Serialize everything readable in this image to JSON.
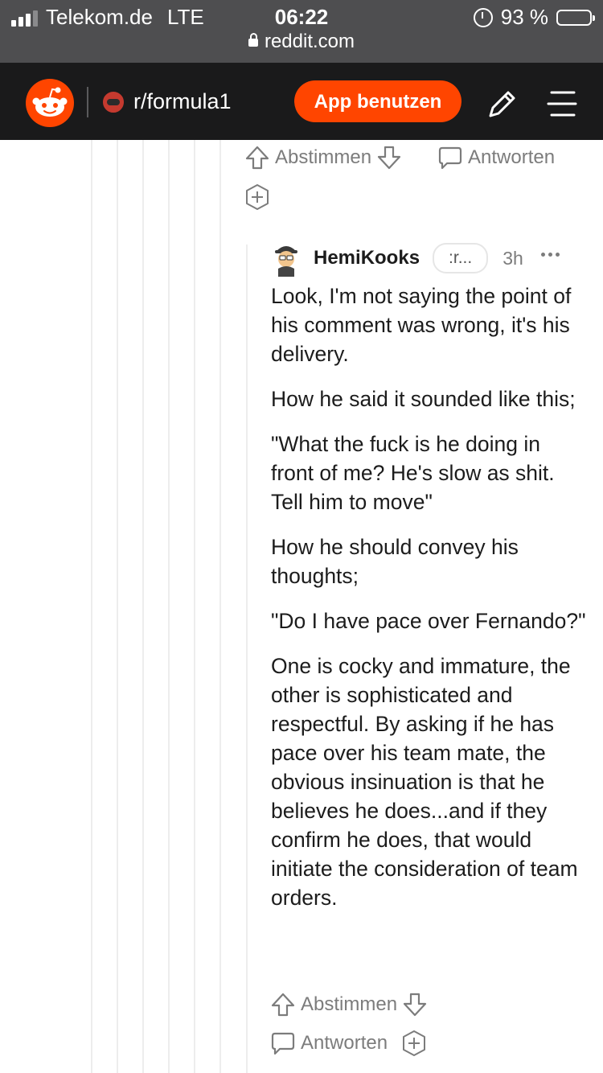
{
  "status_bar": {
    "carrier": "Telekom.de",
    "network": "LTE",
    "time": "06:22",
    "battery_text": "93 %",
    "battery_level": 0.93,
    "url": "reddit.com"
  },
  "header": {
    "logo": "reddit-logo",
    "subreddit": "r/formula1",
    "app_button": "App benutzen",
    "icons": [
      "pencil-icon",
      "menu-icon"
    ],
    "accent_color": "#ff4500",
    "background_color": "#1a1a1b"
  },
  "parent_actions": {
    "vote_label": "Abstimmen",
    "reply_label": "Antworten"
  },
  "comment": {
    "username": "HemiKooks",
    "flair": ":r...",
    "age": "3h",
    "paragraphs": [
      "Look, I'm not saying the point of his comment was wrong, it's his delivery.",
      "How he said it sounded like this;",
      "\"What the fuck is he doing in front of me? He's slow as shit. Tell him to move\"",
      "How he should convey his thoughts;",
      "\"Do I have pace over Fernando?\"",
      "One is cocky and immature, the other is sophisticated and respectful. By asking if he has pace over his team mate, the obvious insinuation is that he believes he does...and if they confirm he does, that would initiate the consideration of team orders."
    ],
    "vote_label": "Abstimmen",
    "reply_label": "Antworten"
  }
}
